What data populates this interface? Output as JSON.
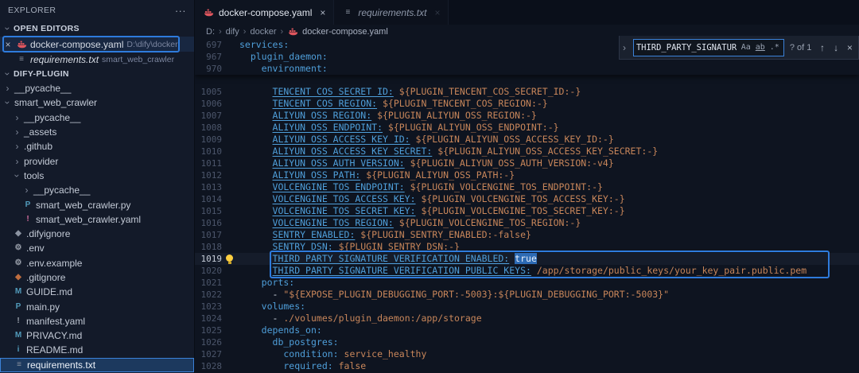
{
  "colors": {
    "annotation": "#2e7bdc",
    "selection": "#2d6bb5",
    "key": "#4f9fda",
    "value": "#c8865a",
    "docker_icon": "#e0565e"
  },
  "glyphs": {
    "chevron": "›"
  },
  "icons": {
    "docker": {
      "name": "docker-whale-icon",
      "glyph": "",
      "color": "#e0565e"
    },
    "txt": {
      "name": "text-file-icon",
      "glyph": "≡",
      "color": "#8b93a1"
    },
    "py": {
      "name": "python-file-icon",
      "glyph": "P",
      "color": "#519aba"
    },
    "yaml": {
      "name": "yaml-file-icon",
      "glyph": "!",
      "color": "#d16d9e"
    },
    "yaml2": {
      "name": "yaml-file-icon",
      "glyph": "!",
      "color": "#9aa0ab"
    },
    "gear": {
      "name": "settings-file-icon",
      "glyph": "⚙",
      "color": "#9aa0ab"
    },
    "ignore": {
      "name": "ignore-file-icon",
      "glyph": "◆",
      "color": "#8b93a1"
    },
    "git": {
      "name": "git-file-icon",
      "glyph": "◆",
      "color": "#bf6d3f"
    },
    "md": {
      "name": "markdown-file-icon",
      "glyph": "M",
      "color": "#519aba"
    },
    "info": {
      "name": "info-file-icon",
      "glyph": "i",
      "color": "#519aba"
    }
  },
  "explorer": {
    "title": "EXPLORER",
    "menu": "···",
    "open_editors": {
      "label": "OPEN EDITORS",
      "items": [
        {
          "close": "×",
          "icon": "docker",
          "name": "docker-compose.yaml",
          "detail": "D:\\dify\\docker",
          "active": true
        },
        {
          "close": "",
          "icon": "txt",
          "name": "requirements.txt",
          "detail": "smart_web_crawler",
          "italic": true
        }
      ]
    },
    "workspace": {
      "label": "DIFY-PLUGIN",
      "tree": [
        {
          "label": "__pycache__",
          "type": "folder",
          "level": 1,
          "expanded": false
        },
        {
          "label": "smart_web_crawler",
          "type": "folder",
          "level": 1,
          "expanded": true
        },
        {
          "label": "__pycache__",
          "type": "folder",
          "level": 2,
          "expanded": false
        },
        {
          "label": "_assets",
          "type": "folder",
          "level": 2,
          "expanded": false
        },
        {
          "label": ".github",
          "type": "folder",
          "level": 2,
          "expanded": false
        },
        {
          "label": "provider",
          "type": "folder",
          "level": 2,
          "expanded": false
        },
        {
          "label": "tools",
          "type": "folder",
          "level": 2,
          "expanded": true
        },
        {
          "label": "__pycache__",
          "type": "folder",
          "level": 3,
          "expanded": false
        },
        {
          "label": "smart_web_crawler.py",
          "type": "file",
          "level": 3,
          "icon": "py"
        },
        {
          "label": "smart_web_crawler.yaml",
          "type": "file",
          "level": 3,
          "icon": "yaml"
        },
        {
          "label": ".difyignore",
          "type": "file",
          "level": 2,
          "icon": "ignore"
        },
        {
          "label": ".env",
          "type": "file",
          "level": 2,
          "icon": "gear"
        },
        {
          "label": ".env.example",
          "type": "file",
          "level": 2,
          "icon": "gear"
        },
        {
          "label": ".gitignore",
          "type": "file",
          "level": 2,
          "icon": "git"
        },
        {
          "label": "GUIDE.md",
          "type": "file",
          "level": 2,
          "icon": "md"
        },
        {
          "label": "main.py",
          "type": "file",
          "level": 2,
          "icon": "py"
        },
        {
          "label": "manifest.yaml",
          "type": "file",
          "level": 2,
          "icon": "yaml2"
        },
        {
          "label": "PRIVACY.md",
          "type": "file",
          "level": 2,
          "icon": "md"
        },
        {
          "label": "README.md",
          "type": "file",
          "level": 2,
          "icon": "info"
        },
        {
          "label": "requirements.txt",
          "type": "file",
          "level": 2,
          "icon": "txt",
          "selected": true
        }
      ]
    }
  },
  "tabs": [
    {
      "label": "docker-compose.yaml",
      "icon": "docker",
      "active": true,
      "italic": false,
      "close": "×"
    },
    {
      "label": "requirements.txt",
      "icon": "txt",
      "active": false,
      "italic": true,
      "close": "×"
    }
  ],
  "breadcrumb": {
    "path": [
      "D:",
      "dify",
      "docker"
    ],
    "separator": "›",
    "file": "docker-compose.yaml"
  },
  "find": {
    "toggle": "›",
    "query": "THIRD_PARTY_SIGNATUR",
    "match_case": "Aa",
    "whole_word": "ab",
    "regex": ".*",
    "results": "? of 1",
    "prev": "↑",
    "next": "↓",
    "close": "×"
  },
  "code": {
    "sticky": [
      {
        "num": "697",
        "indent": 0,
        "tokens": [
          {
            "t": "services:",
            "c": "key"
          }
        ]
      },
      {
        "num": "967",
        "indent": 2,
        "tokens": [
          {
            "t": "plugin_daemon:",
            "c": "key"
          }
        ]
      },
      {
        "num": "970",
        "indent": 4,
        "tokens": [
          {
            "t": "environment:",
            "c": "key"
          }
        ]
      }
    ],
    "lines": [
      {
        "num": "1005",
        "indent": 6,
        "tokens": [
          {
            "t": "TENCENT_COS_SECRET_ID:",
            "c": "keyu"
          },
          {
            "t": " ${PLUGIN_TENCENT_COS_SECRET_ID:-}",
            "c": "val"
          }
        ]
      },
      {
        "num": "1006",
        "indent": 6,
        "tokens": [
          {
            "t": "TENCENT_COS_REGION:",
            "c": "keyu"
          },
          {
            "t": " ${PLUGIN_TENCENT_COS_REGION:-}",
            "c": "val"
          }
        ]
      },
      {
        "num": "1007",
        "indent": 6,
        "tokens": [
          {
            "t": "ALIYUN_OSS_REGION:",
            "c": "keyu"
          },
          {
            "t": " ${PLUGIN_ALIYUN_OSS_REGION:-}",
            "c": "val"
          }
        ]
      },
      {
        "num": "1008",
        "indent": 6,
        "tokens": [
          {
            "t": "ALIYUN_OSS_ENDPOINT:",
            "c": "keyu"
          },
          {
            "t": " ${PLUGIN_ALIYUN_OSS_ENDPOINT:-}",
            "c": "val"
          }
        ]
      },
      {
        "num": "1009",
        "indent": 6,
        "tokens": [
          {
            "t": "ALIYUN_OSS_ACCESS_KEY_ID:",
            "c": "keyu"
          },
          {
            "t": " ${PLUGIN_ALIYUN_OSS_ACCESS_KEY_ID:-}",
            "c": "val"
          }
        ]
      },
      {
        "num": "1010",
        "indent": 6,
        "tokens": [
          {
            "t": "ALIYUN_OSS_ACCESS_KEY_SECRET:",
            "c": "keyu"
          },
          {
            "t": " ${PLUGIN_ALIYUN_OSS_ACCESS_KEY_SECRET:-}",
            "c": "val"
          }
        ]
      },
      {
        "num": "1011",
        "indent": 6,
        "tokens": [
          {
            "t": "ALIYUN_OSS_AUTH_VERSION:",
            "c": "keyu"
          },
          {
            "t": " ${PLUGIN_ALIYUN_OSS_AUTH_VERSION:-v4}",
            "c": "val"
          }
        ]
      },
      {
        "num": "1012",
        "indent": 6,
        "tokens": [
          {
            "t": "ALIYUN_OSS_PATH:",
            "c": "keyu"
          },
          {
            "t": " ${PLUGIN_ALIYUN_OSS_PATH:-}",
            "c": "val"
          }
        ]
      },
      {
        "num": "1013",
        "indent": 6,
        "tokens": [
          {
            "t": "VOLCENGINE_TOS_ENDPOINT:",
            "c": "keyu"
          },
          {
            "t": " ${PLUGIN_VOLCENGINE_TOS_ENDPOINT:-}",
            "c": "val"
          }
        ]
      },
      {
        "num": "1014",
        "indent": 6,
        "tokens": [
          {
            "t": "VOLCENGINE_TOS_ACCESS_KEY:",
            "c": "keyu"
          },
          {
            "t": " ${PLUGIN_VOLCENGINE_TOS_ACCESS_KEY:-}",
            "c": "val"
          }
        ]
      },
      {
        "num": "1015",
        "indent": 6,
        "tokens": [
          {
            "t": "VOLCENGINE_TOS_SECRET_KEY:",
            "c": "keyu"
          },
          {
            "t": " ${PLUGIN_VOLCENGINE_TOS_SECRET_KEY:-}",
            "c": "val"
          }
        ]
      },
      {
        "num": "1016",
        "indent": 6,
        "tokens": [
          {
            "t": "VOLCENGINE_TOS_REGION:",
            "c": "keyu"
          },
          {
            "t": " ${PLUGIN_VOLCENGINE_TOS_REGION:-}",
            "c": "val"
          }
        ]
      },
      {
        "num": "1017",
        "indent": 6,
        "tokens": [
          {
            "t": "SENTRY_ENABLED:",
            "c": "keyu"
          },
          {
            "t": " ${PLUGIN_SENTRY_ENABLED:-false}",
            "c": "val"
          }
        ]
      },
      {
        "num": "1018",
        "indent": 6,
        "tokens": [
          {
            "t": "SENTRY_DSN:",
            "c": "keyu"
          },
          {
            "t": " ${PLUGIN_SENTRY_DSN:-}",
            "c": "val"
          }
        ]
      },
      {
        "num": "1019",
        "indent": 6,
        "current": true,
        "bulb": true,
        "tokens": [
          {
            "t": "THIRD_PARTY_SIGNATURE_VERIFICATION_ENABLED:",
            "c": "keyu"
          },
          {
            "t": " ",
            "c": "plain"
          },
          {
            "t": "true",
            "c": "sel"
          }
        ]
      },
      {
        "num": "1020",
        "indent": 6,
        "tokens": [
          {
            "t": "THIRD_PARTY_SIGNATURE_VERIFICATION_PUBLIC_KEYS:",
            "c": "keyu"
          },
          {
            "t": " /app/storage/public_keys/your_key_pair.public.pem",
            "c": "val"
          }
        ]
      },
      {
        "num": "1021",
        "indent": 4,
        "tokens": [
          {
            "t": "ports:",
            "c": "key"
          }
        ]
      },
      {
        "num": "1022",
        "indent": 6,
        "tokens": [
          {
            "t": "- ",
            "c": "plain"
          },
          {
            "t": "\"${EXPOSE_PLUGIN_DEBUGGING_PORT:-5003}:${PLUGIN_DEBUGGING_PORT:-5003}\"",
            "c": "val"
          }
        ]
      },
      {
        "num": "1023",
        "indent": 4,
        "tokens": [
          {
            "t": "volumes:",
            "c": "key"
          }
        ]
      },
      {
        "num": "1024",
        "indent": 6,
        "tokens": [
          {
            "t": "- ",
            "c": "plain"
          },
          {
            "t": "./volumes/plugin_daemon:/app/storage",
            "c": "val"
          }
        ]
      },
      {
        "num": "1025",
        "indent": 4,
        "tokens": [
          {
            "t": "depends_on:",
            "c": "key"
          }
        ]
      },
      {
        "num": "1026",
        "indent": 6,
        "tokens": [
          {
            "t": "db_postgres:",
            "c": "key"
          }
        ]
      },
      {
        "num": "1027",
        "indent": 8,
        "tokens": [
          {
            "t": "condition:",
            "c": "key"
          },
          {
            "t": " service_healthy",
            "c": "val"
          }
        ]
      },
      {
        "num": "1028",
        "indent": 8,
        "tokens": [
          {
            "t": "required:",
            "c": "key"
          },
          {
            "t": " false",
            "c": "val"
          }
        ]
      }
    ]
  }
}
